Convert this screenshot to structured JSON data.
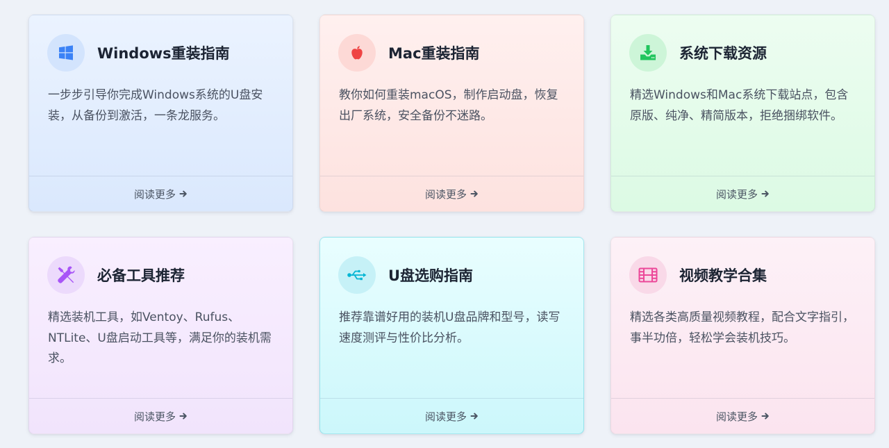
{
  "cards": [
    {
      "title": "Windows重装指南",
      "description": "一步步引导你完成Windows系统的U盘安装，从备份到激活，一条龙服务。",
      "link": "阅读更多",
      "icon": "windows-logo-icon",
      "icon_color": "#3b82f6",
      "icon_bg": "#d3e4fd"
    },
    {
      "title": "Mac重装指南",
      "description": "教你如何重装macOS，制作启动盘，恢复出厂系统，安全备份不迷路。",
      "link": "阅读更多",
      "icon": "apple-logo-icon",
      "icon_color": "#ef4444",
      "icon_bg": "#fdd9d6"
    },
    {
      "title": "系统下载资源",
      "description": "精选Windows和Mac系统下载站点，包含原版、纯净、精简版本，拒绝捆绑软件。",
      "link": "阅读更多",
      "icon": "download-icon",
      "icon_color": "#22c55e",
      "icon_bg": "#cdf5d8"
    },
    {
      "title": "必备工具推荐",
      "description": "精选装机工具，如Ventoy、Rufus、NTLite、U盘启动工具等，满足你的装机需求。",
      "link": "阅读更多",
      "icon": "tools-icon",
      "icon_color": "#a855f7",
      "icon_bg": "#ecdafc"
    },
    {
      "title": "U盘选购指南",
      "description": "推荐靠谱好用的装机U盘品牌和型号，读写速度测评与性价比分析。",
      "link": "阅读更多",
      "icon": "usb-icon",
      "icon_color": "#06b6d4",
      "icon_bg": "#c6f1f7"
    },
    {
      "title": "视频教学合集",
      "description": "精选各类高质量视频教程，配合文字指引，事半功倍，轻松学会装机技巧。",
      "link": "阅读更多",
      "icon": "film-icon",
      "icon_color": "#ec4899",
      "icon_bg": "#f9d9e8"
    }
  ]
}
